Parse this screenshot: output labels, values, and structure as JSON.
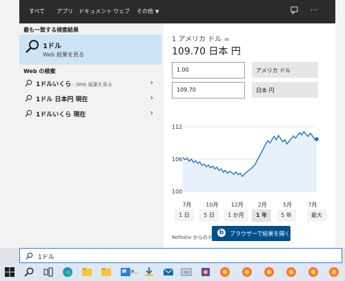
{
  "tabs": [
    {
      "label": "すべて",
      "active": true
    },
    {
      "label": "アプリ"
    },
    {
      "label": "ドキュメント"
    },
    {
      "label": "ウェブ"
    },
    {
      "label": "その他"
    }
  ],
  "left": {
    "best_header": "最も一致する検索結果",
    "best": {
      "title": "1ドル",
      "subtitle": "Web 結果を見る"
    },
    "web_header": "Web の検索",
    "web_items": [
      {
        "main": "1ドルいくら",
        "sub": " - Web 結果を見る"
      },
      {
        "main": "1ドル 日本円 現在",
        "sub": ""
      },
      {
        "main": "1ドルいくら 現在",
        "sub": ""
      }
    ]
  },
  "converter": {
    "from_text": "1 アメリカ ドル =",
    "result_text": "109.70 日本 円",
    "input_value": "1.00",
    "input_unit": "アメリカ ドル",
    "output_value": "109.70",
    "output_unit": "日本 円"
  },
  "chart_data": {
    "type": "area",
    "y_ticks": [
      "112",
      "106",
      "100"
    ],
    "ylim": [
      100,
      112
    ],
    "x_ticks": [
      "7月",
      "10月",
      "12月",
      "2月",
      "5月",
      "7月"
    ],
    "values": [
      106.3,
      105.9,
      106.2,
      105.6,
      106.0,
      105.4,
      105.7,
      105.2,
      105.5,
      104.8,
      105.1,
      104.6,
      104.9,
      104.4,
      104.7,
      104.2,
      104.5,
      103.9,
      104.2,
      103.6,
      103.9,
      103.4,
      103.7,
      103.5,
      103.2,
      103.6,
      103.1,
      103.4,
      102.8,
      103.2,
      103.6,
      103.9,
      104.2,
      104.6,
      105.0,
      105.8,
      106.5,
      107.2,
      108.0,
      108.8,
      109.4,
      109.0,
      109.6,
      110.2,
      109.6,
      110.4,
      109.8,
      109.2,
      109.6,
      108.8,
      109.3,
      109.8,
      110.3,
      109.9,
      110.4,
      110.9,
      110.5,
      111.1,
      110.6,
      110.2,
      110.8,
      110.3,
      109.7,
      109.4
    ],
    "current": 109.7
  },
  "ranges": [
    {
      "label": "1 日"
    },
    {
      "label": "5 日"
    },
    {
      "label": "1 か月"
    },
    {
      "label": "1 年",
      "selected": true
    },
    {
      "label": "5 年"
    },
    {
      "label": "最大"
    }
  ],
  "source_text": "Refinitiv からのデ",
  "open_browser_label": "ブラウザーで結果を開く",
  "search_query": "1ドル",
  "taskbar": {
    "label_p": "P..."
  },
  "colors": {
    "accent": "#2b7cd3",
    "chart_line": "#1f6fc5",
    "chart_fill": "#e6f1fb",
    "selected_bg": "#cce4f7"
  }
}
